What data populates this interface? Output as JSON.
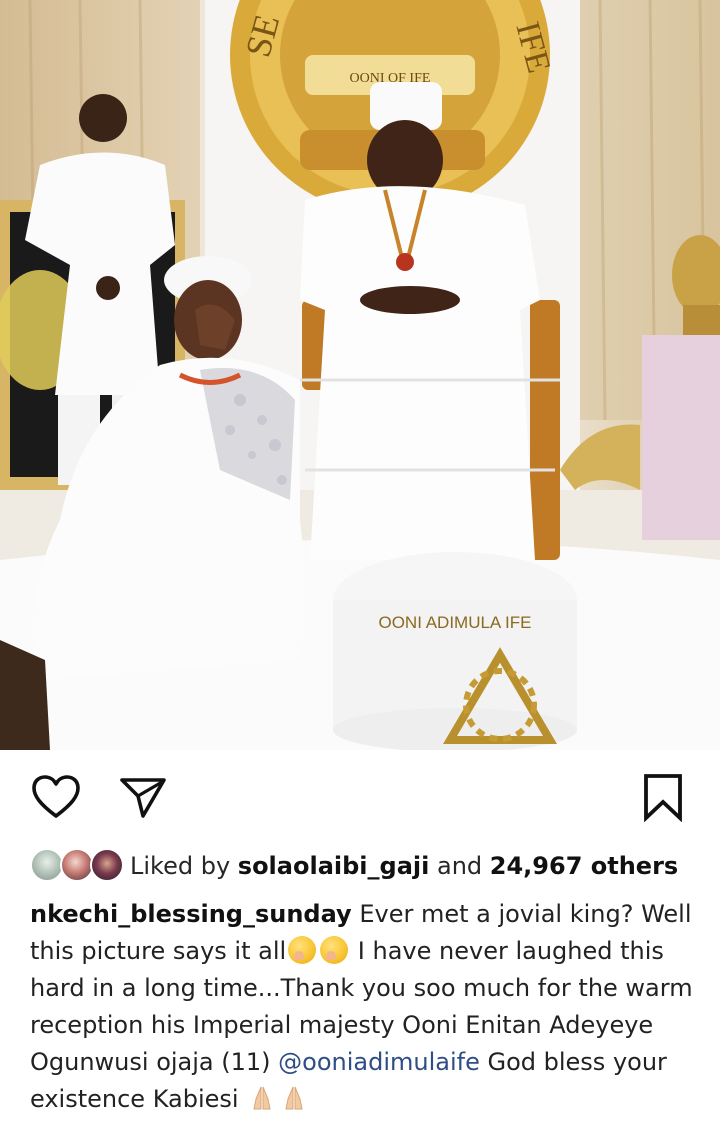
{
  "post": {
    "image_alt": "Woman in white laughing while kneeling beside a smiling king seated on a throne",
    "seal_text_left": "SE",
    "seal_text_right": "IFE",
    "seal_banner": "OONI OF IFE",
    "pouf_text": "OONI ADIMULA IFE"
  },
  "actions": {
    "like_icon": "heart-outline-icon",
    "share_icon": "paper-plane-icon",
    "save_icon": "bookmark-outline-icon"
  },
  "likes": {
    "prefix": "Liked by ",
    "user": "solaolaibi_gaji",
    "middle": " and ",
    "count": "24,967 others"
  },
  "caption": {
    "username": "nkechi_blessing_sunday",
    "text_1": " Ever met a jovial king? Well this picture says it all",
    "text_2": " I have never laughed this hard in a long time...Thank you soo much for the warm reception his Imperial majesty Ooni Enitan Adeyeye Ogunwusi ojaja (11) ",
    "mention": "@ooniadimulaife",
    "text_3": " God bless your existence Kabiesi "
  }
}
